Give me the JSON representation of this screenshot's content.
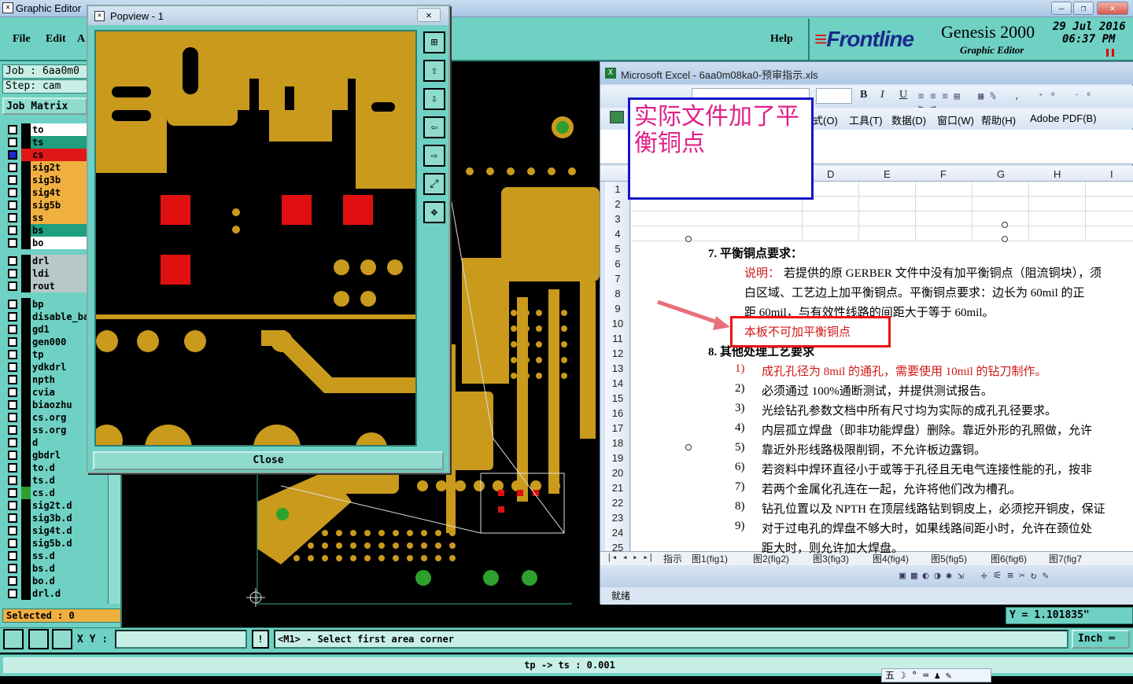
{
  "app": {
    "title": "Graphic Editor",
    "menus": [
      "File",
      "Edit",
      "Help"
    ],
    "menu_partial": "A",
    "brand": "Frontline",
    "product": "Genesis 2000",
    "product_sub": "Graphic Editor",
    "date": "29 Jul 2016",
    "time": "06:37 PM",
    "job": "Job : 6aa0m0",
    "step": "Step: cam",
    "job_matrix": "Job Matrix",
    "selected": "Selected : 0",
    "xy_label": "X Y :",
    "status_msg": "<M1> - Select first area corner",
    "unit": "Inch",
    "info": "tp -> ts : 0.001",
    "y_readout": "Y = 1.101835\"",
    "ime": "五 ☽ ° ⌨ ♟ ✎",
    "colors": {
      "teal": "#6fd1c3",
      "copper": "#c99a1c",
      "red_pad": "#e01010",
      "callout_text": "#e0208a"
    }
  },
  "layers": [
    {
      "name": "to",
      "color": "#ffffff"
    },
    {
      "name": "ts",
      "color": "#1f9e80"
    },
    {
      "name": "cs",
      "color": "#e01818"
    },
    {
      "name": "sig2t",
      "color": "#f0b040"
    },
    {
      "name": "sig3b",
      "color": "#f0b040"
    },
    {
      "name": "sig4t",
      "color": "#f0b040"
    },
    {
      "name": "sig5b",
      "color": "#f0b040"
    },
    {
      "name": "ss",
      "color": "#f0b040"
    },
    {
      "name": "bs",
      "color": "#1f9e80"
    },
    {
      "name": "bo",
      "color": "#ffffff"
    },
    {
      "name": "drl",
      "color": "#b8c8c8"
    },
    {
      "name": "ldi",
      "color": "#b8c8c8"
    },
    {
      "name": "rout",
      "color": "#b8c8c8"
    },
    {
      "name": "bp",
      "color": "#6fd1c3"
    },
    {
      "name": "disable_ba",
      "color": "#6fd1c3"
    },
    {
      "name": "gd1",
      "color": "#6fd1c3"
    },
    {
      "name": "gen000",
      "color": "#6fd1c3"
    },
    {
      "name": "tp",
      "color": "#6fd1c3"
    },
    {
      "name": "ydkdrl",
      "color": "#6fd1c3"
    },
    {
      "name": "npth",
      "color": "#6fd1c3"
    },
    {
      "name": "cvia",
      "color": "#6fd1c3"
    },
    {
      "name": "biaozhu",
      "color": "#6fd1c3"
    },
    {
      "name": "cs.org",
      "color": "#6fd1c3"
    },
    {
      "name": "ss.org",
      "color": "#6fd1c3"
    },
    {
      "name": "d",
      "color": "#6fd1c3"
    },
    {
      "name": "gbdrl",
      "color": "#6fd1c3"
    },
    {
      "name": "to.d",
      "color": "#6fd1c3"
    },
    {
      "name": "ts.d",
      "color": "#6fd1c3"
    },
    {
      "name": "cs.d",
      "color": "#6fd1c3"
    },
    {
      "name": "sig2t.d",
      "color": "#6fd1c3"
    },
    {
      "name": "sig3b.d",
      "color": "#6fd1c3"
    },
    {
      "name": "sig4t.d",
      "color": "#6fd1c3"
    },
    {
      "name": "sig5b.d",
      "color": "#6fd1c3"
    },
    {
      "name": "ss.d",
      "color": "#6fd1c3"
    },
    {
      "name": "bs.d",
      "color": "#6fd1c3"
    },
    {
      "name": "bo.d",
      "color": "#6fd1c3"
    },
    {
      "name": "drl.d",
      "color": "#6fd1c3"
    }
  ],
  "popview": {
    "title": "Popview - 1",
    "close_label": "Close",
    "close_x": "✕"
  },
  "excel": {
    "title": "Microsoft Excel - 6aa0m08ka0-预审指示.xls",
    "menus": [
      "式(O)",
      "工具(T)",
      "数据(D)",
      "窗口(W)",
      "帮助(H)",
      "Adobe PDF(B)"
    ],
    "columns": [
      "D",
      "E",
      "F",
      "G",
      "H",
      "I"
    ],
    "rows": [
      "1",
      "2",
      "3",
      "4",
      "5",
      "6",
      "7",
      "8",
      "9",
      "10",
      "11",
      "12",
      "13",
      "14",
      "15",
      "16",
      "17",
      "18",
      "19",
      "20",
      "21",
      "22",
      "23",
      "24",
      "25"
    ],
    "heading7": "7.   平衡铜点要求：",
    "note_prefix": "说明：",
    "note_1": "若提供的原 GERBER 文件中没有加平衡铜点（阻流铜块），须",
    "note_2": "白区域、工艺边上加平衡铜点。平衡铜点要求：边长为 60mil 的正",
    "note_3": "距 60mil，与有效性线路的间距大于等于 60mil。",
    "highlight": "本板不可加平衡铜点",
    "heading8": "8.   其他处理工艺要求",
    "items": [
      {
        "num": "1)",
        "text": "成孔孔径为 8mil 的通孔，需要使用 10mil 的钻刀制作。",
        "red": true
      },
      {
        "num": "2)",
        "text": "必须通过 100%通断测试，并提供测试报告。",
        "red": false
      },
      {
        "num": "3)",
        "text": "光绘钻孔参数文档中所有尺寸均为实际的成孔孔径要求。",
        "red": false
      },
      {
        "num": "4)",
        "text": "内层孤立焊盘（即非功能焊盘）删除。靠近外形的孔照做，允许",
        "red": false
      },
      {
        "num": "5)",
        "text": "靠近外形线路极限削铜，不允许板边露铜。",
        "red": false
      },
      {
        "num": "6)",
        "text": "若资料中焊环直径小于或等于孔径且无电气连接性能的孔，按非",
        "red": false
      },
      {
        "num": "7)",
        "text": "若两个金属化孔连在一起，允许将他们改为槽孔。",
        "red": false
      },
      {
        "num": "8)",
        "text": "钻孔位置以及 NPTH 在顶层线路钻到铜皮上，必须挖开铜皮，保证",
        "red": false
      },
      {
        "num": "9)",
        "text": "对于过电孔的焊盘不够大时，如果线路间距小时，允许在颈位处",
        "red": false
      }
    ],
    "last_line": "距大时，则允许加大焊盘。",
    "tabs": [
      "指示",
      "图1(fig1)",
      "图2(fig2)",
      "图3(fig3)",
      "图4(fig4)",
      "图5(fig5)",
      "图6(fig6)",
      "图7(fig7"
    ],
    "status": "就绪"
  },
  "callout": {
    "text": "实际文件加了平衡铜点"
  }
}
